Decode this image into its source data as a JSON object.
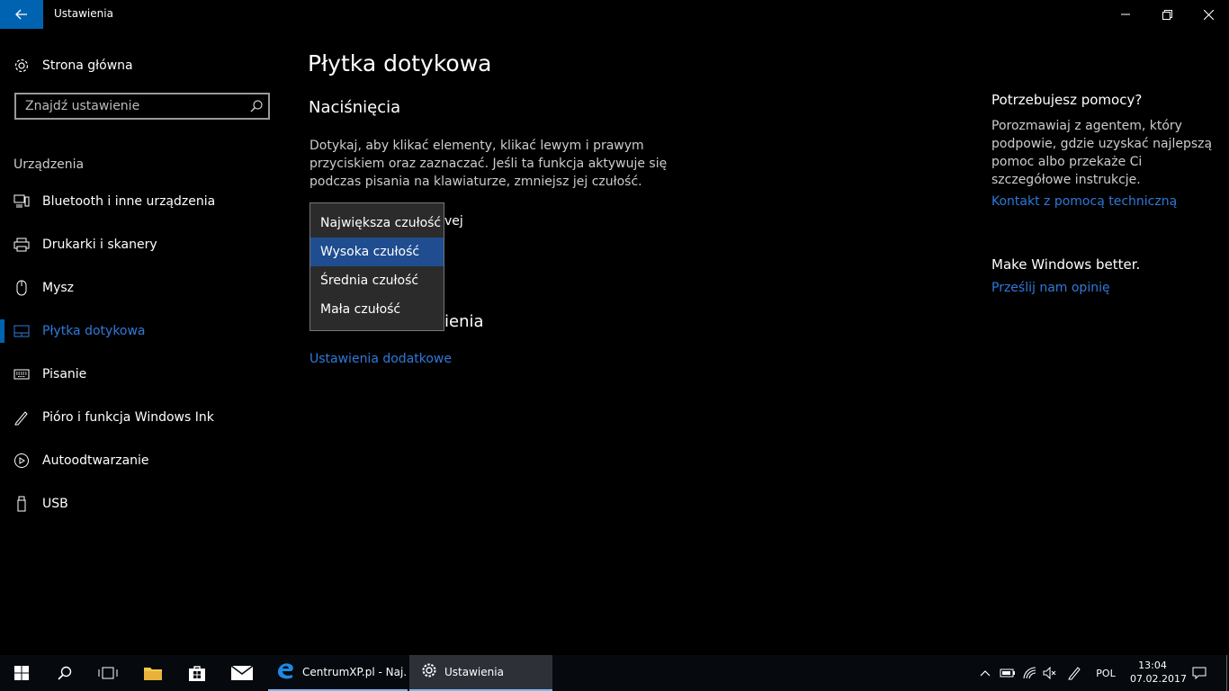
{
  "window": {
    "title": "Ustawienia",
    "accent": "#0063b1"
  },
  "sidebar": {
    "home_label": "Strona główna",
    "search_placeholder": "Znajdź ustawienie",
    "section_label": "Urządzenia",
    "items": [
      {
        "label": "Bluetooth i inne urządzenia",
        "icon": "bluetooth-devices-icon"
      },
      {
        "label": "Drukarki i skanery",
        "icon": "printer-icon"
      },
      {
        "label": "Mysz",
        "icon": "mouse-icon"
      },
      {
        "label": "Płytka dotykowa",
        "icon": "touchpad-icon",
        "active": true
      },
      {
        "label": "Pisanie",
        "icon": "keyboard-icon"
      },
      {
        "label": "Pióro i funkcja Windows Ink",
        "icon": "pen-icon"
      },
      {
        "label": "Autoodtwarzanie",
        "icon": "autoplay-icon"
      },
      {
        "label": "USB",
        "icon": "usb-icon"
      }
    ]
  },
  "main": {
    "title": "Płytka dotykowa",
    "section_title": "Naciśnięcia",
    "description": "Dotykaj, aby klikać elementy, klikać lewym i prawym przyciskiem oraz zaznaczać. Jeśli ta funkcja aktywuje się podczas pisania na klawiaturze, zmniejsz jej czułość.",
    "hidden_label_fragment": "vej",
    "hidden_heading_fragment": "ienia",
    "additional_settings_link": "Ustawienia dodatkowe",
    "sensitivity_dropdown": {
      "options": [
        "Największa czułość",
        "Wysoka czułość",
        "Średnia czułość",
        "Mała czułość"
      ],
      "selected": "Wysoka czułość"
    }
  },
  "help": {
    "title": "Potrzebujesz pomocy?",
    "text": "Porozmawiaj z agentem, który podpowie, gdzie uzyskać najlepszą pomoc albo przekaże Ci szczegółowe instrukcje.",
    "support_link": "Kontakt z pomocą techniczną",
    "feedback_title": "Make Windows better.",
    "feedback_link": "Prześlij nam opinię"
  },
  "taskbar": {
    "apps": [
      {
        "label": "CentrumXP.pl - Naj...",
        "icon": "edge-icon"
      },
      {
        "label": "Ustawienia",
        "icon": "settings-gear-icon"
      }
    ],
    "language": "POL",
    "time": "13:04",
    "date": "07.02.2017"
  }
}
